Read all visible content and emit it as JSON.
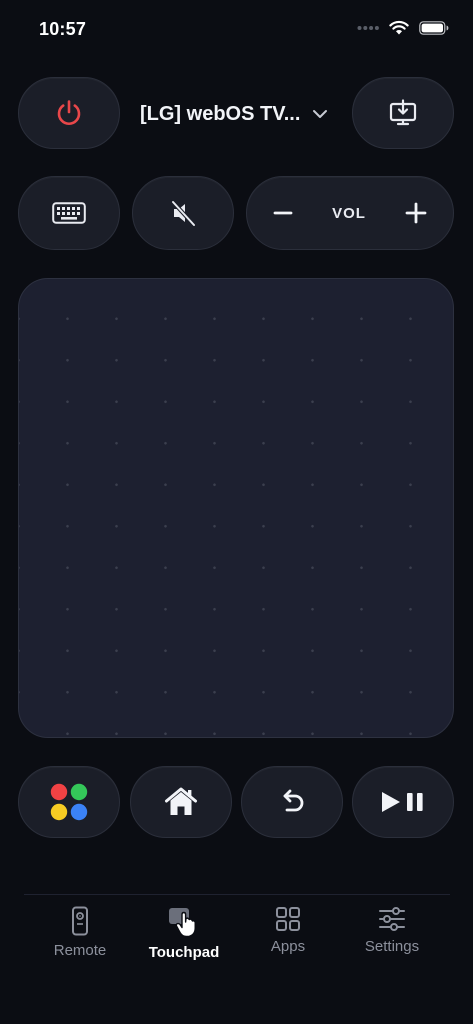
{
  "status_bar": {
    "time": "10:57"
  },
  "header": {
    "device_name": "[LG] webOS TV..."
  },
  "volume": {
    "label": "VOL"
  },
  "colors": {
    "power_red": "#e8474a",
    "dot_red": "#f14244",
    "dot_green": "#34c759",
    "dot_yellow": "#f7cc23",
    "dot_blue": "#3b82f6"
  },
  "nav": {
    "items": [
      {
        "label": "Remote",
        "icon": "remote-icon",
        "active": false
      },
      {
        "label": "Touchpad",
        "icon": "touchpad-icon",
        "active": true
      },
      {
        "label": "Apps",
        "icon": "apps-grid-icon",
        "active": false
      },
      {
        "label": "Settings",
        "icon": "sliders-icon",
        "active": false
      }
    ]
  }
}
